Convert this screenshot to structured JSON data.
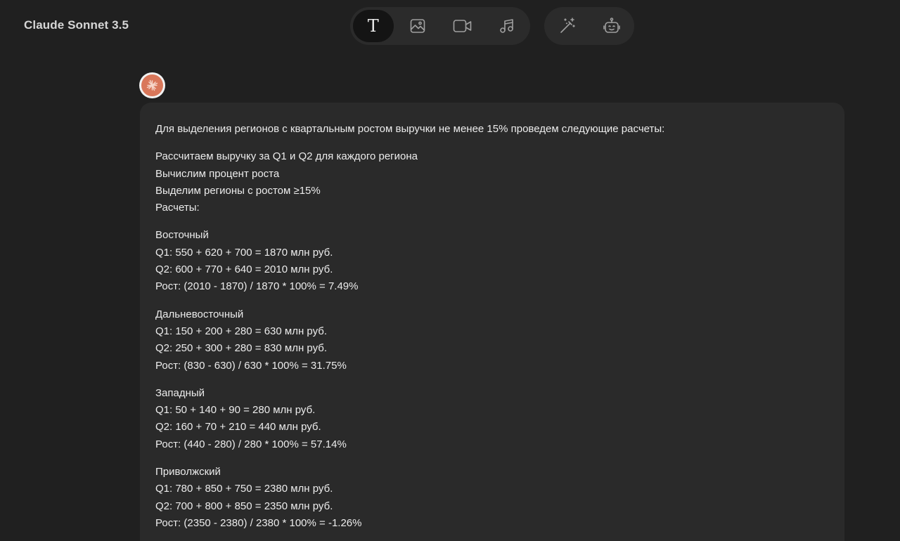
{
  "app": {
    "title": "Claude Sonnet 3.5"
  },
  "toolbar": {
    "modes": [
      {
        "name": "text-mode",
        "icon": "text-icon",
        "glyph": "T",
        "active": true
      },
      {
        "name": "image-mode",
        "icon": "image-icon",
        "active": false
      },
      {
        "name": "video-mode",
        "icon": "video-icon",
        "active": false
      },
      {
        "name": "music-mode",
        "icon": "music-icon",
        "active": false
      }
    ],
    "tools": [
      {
        "name": "magic-wand",
        "icon": "magic-wand-icon"
      },
      {
        "name": "bot",
        "icon": "robot-icon"
      }
    ]
  },
  "message": {
    "avatar_icon": "claude-logo-icon",
    "intro": "Для выделения регионов с квартальным ростом выручки не менее 15% проведем следующие расчеты:",
    "steps": [
      "Рассчитаем выручку за Q1 и Q2 для каждого региона",
      "Вычислим процент роста",
      "Выделим регионы с ростом ≥15%",
      "Расчеты:"
    ],
    "regions": [
      {
        "name": "Восточный",
        "q1": "Q1: 550 + 620 + 700 = 1870 млн руб.",
        "q2": "Q2: 600 + 770 + 640 = 2010 млн руб.",
        "growth": "Рост: (2010 - 1870) / 1870 * 100% = 7.49%"
      },
      {
        "name": "Дальневосточный",
        "q1": "Q1: 150 + 200 + 280 = 630 млн руб.",
        "q2": "Q2: 250 + 300 + 280 = 830 млн руб.",
        "growth": "Рост: (830 - 630) / 630 * 100% = 31.75%"
      },
      {
        "name": "Западный",
        "q1": "Q1: 50 + 140 + 90 = 280 млн руб.",
        "q2": "Q2: 160 + 70 + 210 = 440 млн руб.",
        "growth": "Рост: (440 - 280) / 280 * 100% = 57.14%"
      },
      {
        "name": "Приволжский",
        "q1": "Q1: 780 + 850 + 750 = 2380 млн руб.",
        "q2": "Q2: 700 + 800 + 850 = 2350 млн руб.",
        "growth": "Рост: (2350 - 2380) / 2380 * 100% = -1.26%"
      }
    ]
  },
  "colors": {
    "background": "#202020",
    "toolbar_bg": "#2b2b2b",
    "active_button_bg": "#141414",
    "message_bg": "#2a2a2a",
    "text": "#ececec",
    "avatar_accent": "#d9775a"
  }
}
